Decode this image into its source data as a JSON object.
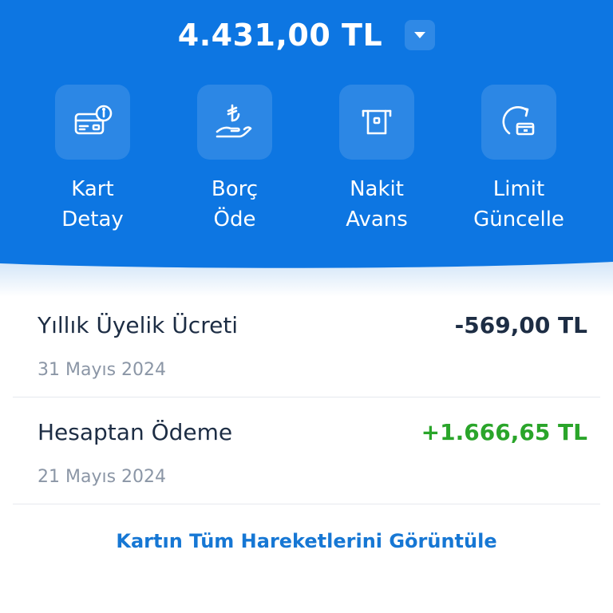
{
  "summary": {
    "balance": "4.431,00 TL"
  },
  "actions": [
    {
      "icon": "card-info-icon",
      "line1": "Kart",
      "line2": "Detay"
    },
    {
      "icon": "hand-lira-icon",
      "line1": "Borç",
      "line2": "Öde"
    },
    {
      "icon": "atm-cash-icon",
      "line1": "Nakit",
      "line2": "Avans"
    },
    {
      "icon": "limit-refresh-icon",
      "line1": "Limit",
      "line2": "Güncelle"
    }
  ],
  "transactions": [
    {
      "title": "Yıllık Üyelik Ücreti",
      "date": "31 Mayıs 2024",
      "amount": "-569,00 TL",
      "color": "#1d2d44"
    },
    {
      "title": "Hesaptan Ödeme",
      "date": "21 Mayıs 2024",
      "amount": "+1.666,65 TL",
      "color": "#2aa52a"
    }
  ],
  "footer": {
    "view_all": "Kartın Tüm Hareketlerini Görüntüle"
  },
  "colors": {
    "header_bg": "#0d76e2",
    "positive": "#2aa52a",
    "link": "#1677d4"
  }
}
